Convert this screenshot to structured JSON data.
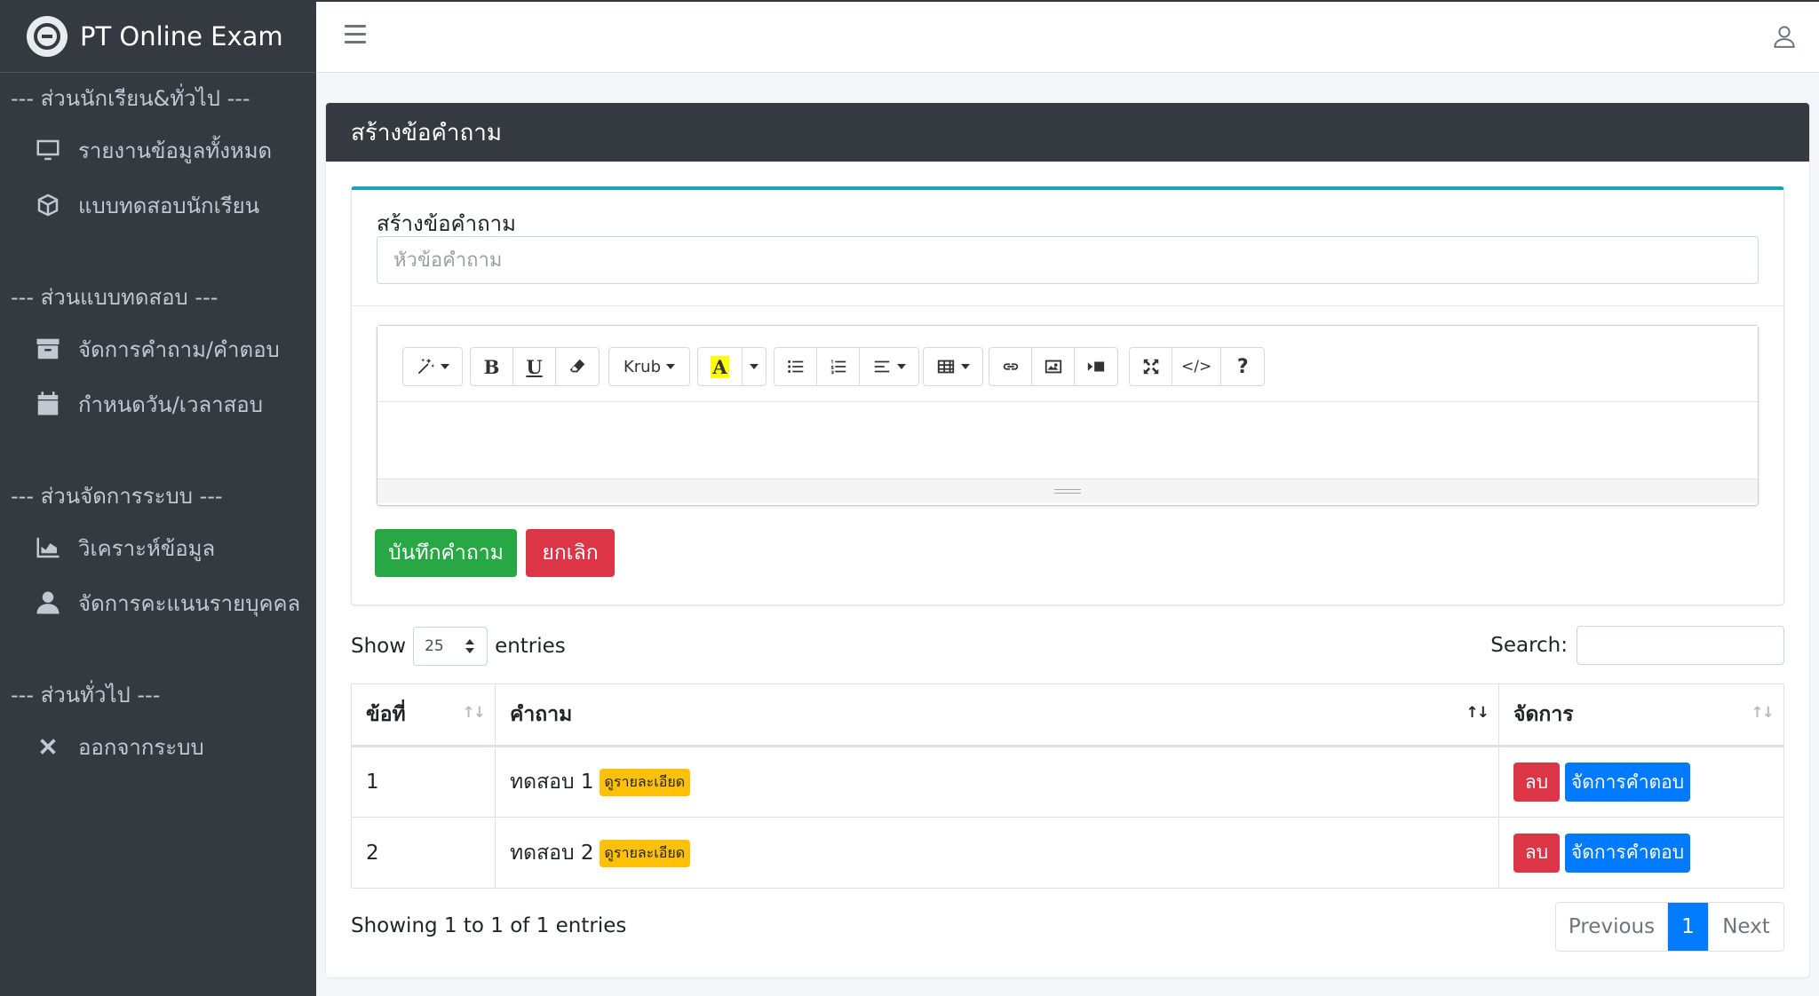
{
  "brand": {
    "name": "PT Online Exam"
  },
  "sidebar": {
    "sections": [
      {
        "header": "--- ส่วนนักเรียน&ทั่วไป ---",
        "items": [
          {
            "label": "รายงานข้อมูลทั้งหมด",
            "icon": "monitor-icon"
          },
          {
            "label": "แบบทดสอบนักเรียน",
            "icon": "cube-icon"
          }
        ]
      },
      {
        "header": "--- ส่วนแบบทดสอบ ---",
        "items": [
          {
            "label": "จัดการคำถาม/คำตอบ",
            "icon": "archive-icon"
          },
          {
            "label": "กำหนดวัน/เวลาสอบ",
            "icon": "calendar-icon"
          }
        ]
      },
      {
        "header": "--- ส่วนจัดการระบบ ---",
        "items": [
          {
            "label": "วิเคราะห์ข้อมูล",
            "icon": "area-chart-icon"
          },
          {
            "label": "จัดการคะแนนรายบุคคล",
            "icon": "user-icon"
          }
        ]
      },
      {
        "header": "--- ส่วนทั่วไป ---",
        "items": [
          {
            "label": "ออกจากระบบ",
            "icon": "close-icon"
          }
        ]
      }
    ]
  },
  "page": {
    "title": "สร้างข้อคำถาม"
  },
  "form": {
    "label": "สร้างข้อคำถาม",
    "title_placeholder": "หัวข้อคำถาม",
    "title_value": "",
    "font_name": "Krub",
    "color_letter": "A",
    "save_label": "บันทึกคำถาม",
    "cancel_label": "ยกเลิก"
  },
  "datatable": {
    "show_label": "Show",
    "page_size": "25",
    "entries_label": "entries",
    "search_label": "Search:",
    "columns": [
      "ข้อที่",
      "คำถาม",
      "จัดการ"
    ],
    "rows": [
      {
        "no": "1",
        "question": "ทดสอบ 1",
        "badge": "ดูรายละเอียด",
        "delete_label": "ลบ",
        "manage_label": "จัดการคำตอบ"
      },
      {
        "no": "2",
        "question": "ทดสอบ 2",
        "badge": "ดูรายละเอียด",
        "delete_label": "ลบ",
        "manage_label": "จัดการคำตอบ"
      }
    ],
    "info": "Showing 1 to 1 of 1 entries",
    "pager": {
      "previous": "Previous",
      "current": "1",
      "next": "Next"
    }
  },
  "colors": {
    "sidebar": "#343a40",
    "accent_top": "#17a2b8",
    "save": "#28a745",
    "danger": "#dc3545",
    "primary": "#007bff",
    "badge": "#ffc107"
  }
}
